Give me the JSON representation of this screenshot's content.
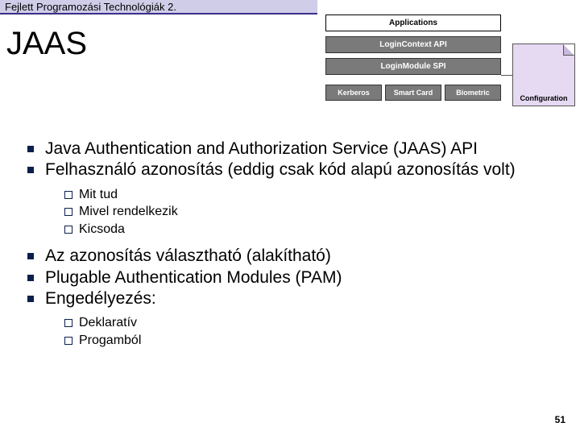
{
  "header": "Fejlett Programozási Technológiák 2.",
  "title": "JAAS",
  "diagram": {
    "top_box": "Applications",
    "mid1": "LoginContext API",
    "mid2": "LoginModule SPI",
    "bottom": [
      "Kerberos",
      "Smart Card",
      "Biometric"
    ],
    "config": "Configuration"
  },
  "bullets1": [
    "Java Authentication and Authorization Service (JAAS) API",
    "Felhasználó azonosítás (eddig csak kód alapú azonosítás volt)"
  ],
  "sub1": [
    "Mit tud",
    "Mivel rendelkezik",
    "Kicsoda"
  ],
  "bullets2": [
    "Az azonosítás választható (alakítható)",
    "Plugable Authentication Modules (PAM)",
    "Engedélyezés:"
  ],
  "sub2": [
    "Deklaratív",
    "Progamból"
  ],
  "page": "51"
}
